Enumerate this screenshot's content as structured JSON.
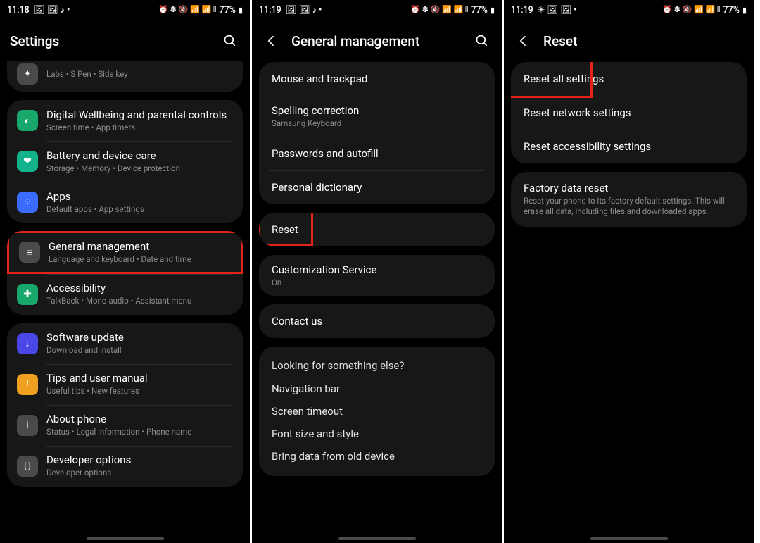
{
  "status": {
    "time1": "11:18",
    "time2": "11:19",
    "time3": "11:19",
    "leftIcons": "🖼 🖼 ♪  •",
    "leftIcons2": "🖼 🖼 ♪  •",
    "leftIcons3": "✳ 🖼 🖼  •",
    "rightIcons": "⏰ ✽ 🔇 📶 📶 ⫴",
    "battery": "77%"
  },
  "p1": {
    "title": "Settings",
    "items": [
      {
        "title": "",
        "sub": "Labs  •  S Pen  •  Side key",
        "iconColor": "#4a4a4a",
        "iconGlyph": "✦"
      },
      {
        "title": "Digital Wellbeing and parental controls",
        "sub": "Screen time  •  App timers",
        "iconColor": "#18a86b",
        "iconGlyph": "◐"
      },
      {
        "title": "Battery and device care",
        "sub": "Storage  •  Memory  •  Device protection",
        "iconColor": "#12b38a",
        "iconGlyph": "❤"
      },
      {
        "title": "Apps",
        "sub": "Default apps  •  App settings",
        "iconColor": "#3a6cff",
        "iconGlyph": "⁘"
      },
      {
        "title": "General management",
        "sub": "Language and keyboard  •  Date and time",
        "iconColor": "#4a4a4a",
        "iconGlyph": "≡"
      },
      {
        "title": "Accessibility",
        "sub": "TalkBack  •  Mono audio  •  Assistant menu",
        "iconColor": "#18a86b",
        "iconGlyph": "✚"
      },
      {
        "title": "Software update",
        "sub": "Download and install",
        "iconColor": "#4a46e8",
        "iconGlyph": "↓"
      },
      {
        "title": "Tips and user manual",
        "sub": "Useful tips  •  New features",
        "iconColor": "#f0a020",
        "iconGlyph": "!"
      },
      {
        "title": "About phone",
        "sub": "Status  •  Legal information  •  Phone name",
        "iconColor": "#4a4a4a",
        "iconGlyph": "i"
      },
      {
        "title": "Developer options",
        "sub": "Developer options",
        "iconColor": "#4a4a4a",
        "iconGlyph": "{}"
      }
    ]
  },
  "p2": {
    "title": "General management",
    "g1": [
      {
        "title": "Mouse and trackpad"
      },
      {
        "title": "Spelling correction",
        "sub": "Samsung Keyboard"
      },
      {
        "title": "Passwords and autofill"
      },
      {
        "title": "Personal dictionary"
      }
    ],
    "g2": [
      {
        "title": "Reset"
      }
    ],
    "g3": [
      {
        "title": "Customization Service",
        "sub": "On"
      }
    ],
    "g4": [
      {
        "title": "Contact us"
      }
    ],
    "g5_heading": "Looking for something else?",
    "g5": [
      {
        "title": "Navigation bar"
      },
      {
        "title": "Screen timeout"
      },
      {
        "title": "Font size and style"
      },
      {
        "title": "Bring data from old device"
      }
    ]
  },
  "p3": {
    "title": "Reset",
    "g1": [
      {
        "title": "Reset all settings"
      },
      {
        "title": "Reset network settings"
      },
      {
        "title": "Reset accessibility settings"
      }
    ],
    "g2": [
      {
        "title": "Factory data reset",
        "sub": "Reset your phone to its factory default settings. This will erase all data, including files and downloaded apps."
      }
    ]
  }
}
